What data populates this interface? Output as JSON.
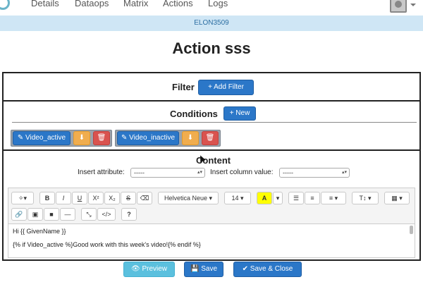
{
  "nav": {
    "items": [
      "Details",
      "Dataops",
      "Matrix",
      "Actions",
      "Logs"
    ]
  },
  "strip": {
    "label": "ELON3509"
  },
  "page": {
    "title": "Action sss"
  },
  "filter": {
    "label": "Filter",
    "add_button": "+ Add Filter"
  },
  "conditions": {
    "label": "Conditions",
    "new_button": "+ New",
    "items": [
      {
        "label": "✎ Video_active"
      },
      {
        "label": "✎ Video_inactive"
      }
    ]
  },
  "content": {
    "label": "Content",
    "insert_attribute_label": "Insert attribute:",
    "insert_attribute_value": "-----",
    "insert_column_label": "Insert column value:",
    "insert_column_value": "-----"
  },
  "toolbar": {
    "magic": "✧▾",
    "bold": "B",
    "italic": "I",
    "underline": "U",
    "superscript": "X²",
    "subscript": "X₂",
    "strike": "S",
    "eraser": "⌫",
    "font_name": "Helvetica Neue ▾",
    "font_size": "14 ▾",
    "color": "A",
    "color_caret": "▾",
    "ul": "☰",
    "ol": "≡",
    "align": "≡ ▾",
    "height": "T↕ ▾",
    "table": "▦ ▾",
    "link": "🔗",
    "picture": "▣",
    "video": "■",
    "hr": "—",
    "fullscreen": "⤡",
    "code": "</>",
    "help": "?"
  },
  "editor": {
    "lines": [
      "Hi {{ GivenName }}",
      "{% if Video_active %}Good work with this week's video!{% endif %}"
    ]
  },
  "footer": {
    "preview": "👁 Preview",
    "save": "💾 Save",
    "save_close": "✔ Save & Close"
  },
  "colors": {
    "primary": "#2b77c8",
    "info": "#5bc0de",
    "warning": "#f0ad4e",
    "danger": "#d9534f",
    "strip": "#cfe6f5"
  }
}
